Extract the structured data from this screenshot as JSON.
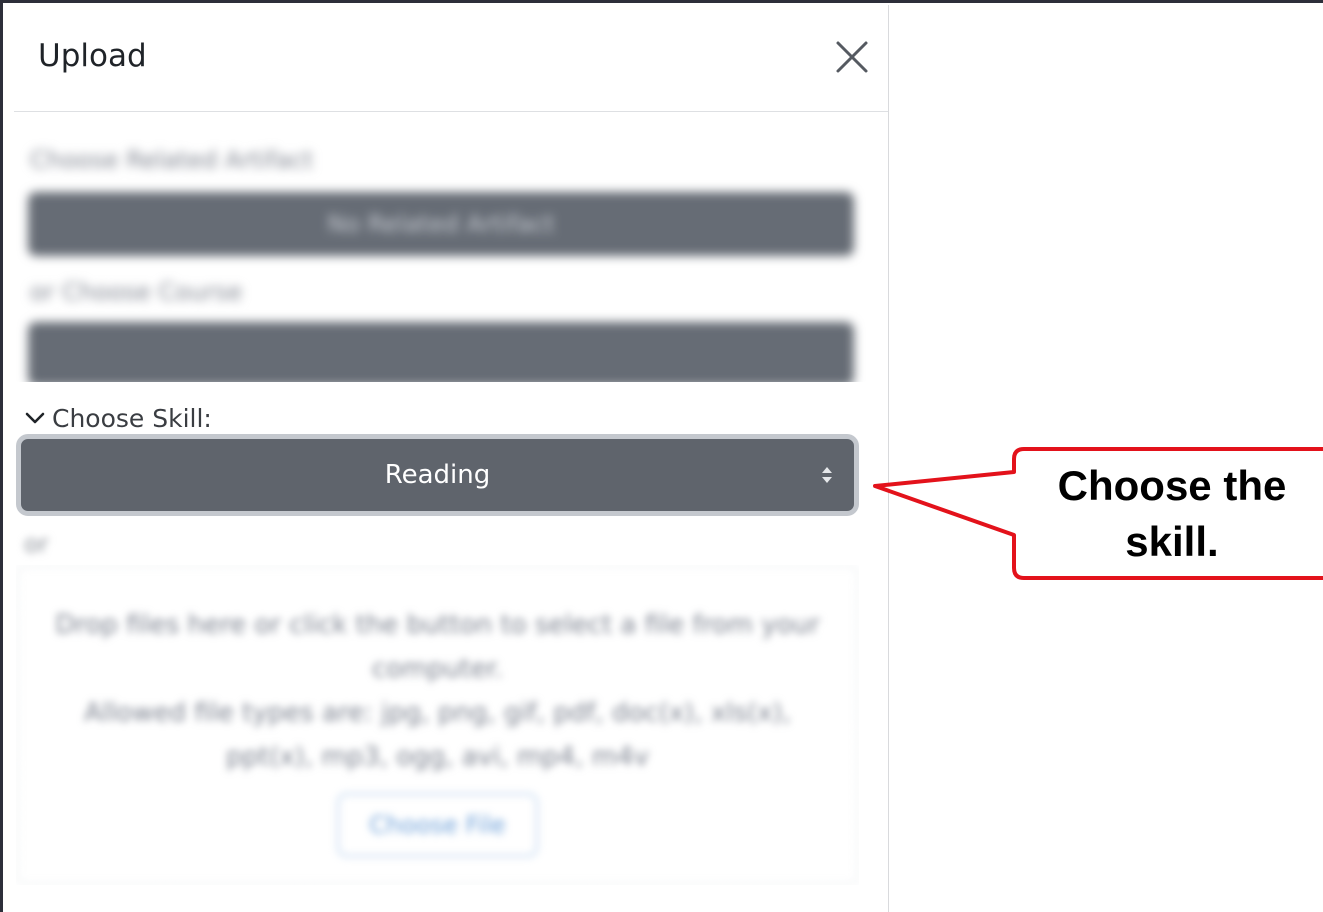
{
  "dialog": {
    "title": "Upload",
    "close_icon": "close-icon"
  },
  "blurred": {
    "related_label": "Choose Related Artifact",
    "related_value": "No Related Artifact",
    "course_label": "or Choose Course",
    "or_label": "or",
    "dropzone_line1": "Drop files here or click the button to select a file from your",
    "dropzone_line2": "computer.",
    "dropzone_line3": "Allowed file types are: jpg, png, gif, pdf, doc(x), xls(x),",
    "dropzone_line4": "ppt(x), mp3, ogg, avi, mp4, m4v",
    "choose_file": "Choose File"
  },
  "skill": {
    "label": "Choose Skill:",
    "value": "Reading",
    "chevron_icon": "chevron-down-icon",
    "sort_icon": "select-arrows-icon"
  },
  "callout": {
    "text_line1": "Choose the",
    "text_line2": "skill.",
    "border_color": "#e3121b"
  },
  "colors": {
    "select_bg": "#5f646c",
    "select_border": "#c4c8ce"
  }
}
